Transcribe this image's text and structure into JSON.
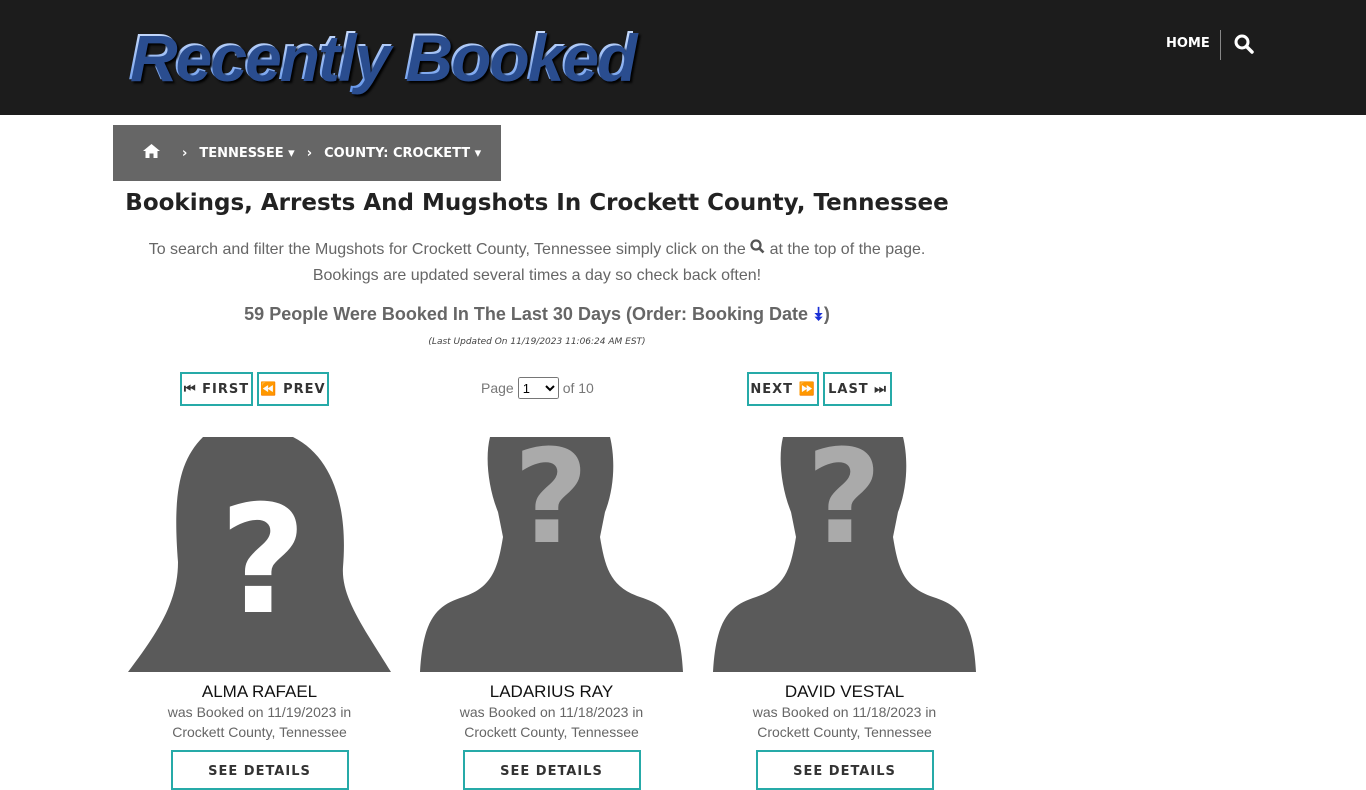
{
  "header": {
    "logo": "Recently Booked",
    "home": "HOME"
  },
  "breadcrumb": {
    "state": "TENNESSEE",
    "county": "COUNTY: CROCKETT"
  },
  "title": "Bookings, Arrests And Mugshots In Crockett County, Tennessee",
  "desc1a": "To search and filter the Mugshots for Crockett County, Tennessee simply click on the",
  "desc1b": "at the top of the page.",
  "desc2": "Bookings are updated several times a day so check back often!",
  "count": "59 People Were Booked In The Last 30 Days (Order: Booking Date",
  "count_end": ")",
  "updated": "(Last Updated On 11/19/2023 11:06:24 AM EST)",
  "pager": {
    "first": "FIRST",
    "prev": "PREV",
    "next": "NEXT",
    "last": "LAST",
    "page_label": "Page",
    "page": "1",
    "of": "of 10"
  },
  "cards": [
    {
      "name": "ALMA RAFAEL",
      "line1": "was Booked on 11/19/2023 in",
      "line2": "Crockett County, Tennessee",
      "button": "SEE DETAILS",
      "silhouette": "female"
    },
    {
      "name": "LADARIUS RAY",
      "line1": "was Booked on 11/18/2023 in",
      "line2": "Crockett County, Tennessee",
      "button": "SEE DETAILS",
      "silhouette": "male"
    },
    {
      "name": "DAVID VESTAL",
      "line1": "was Booked on 11/18/2023 in",
      "line2": "Crockett County, Tennessee",
      "button": "SEE DETAILS",
      "silhouette": "male"
    }
  ],
  "colors": {
    "header": "#1c1c1c",
    "breadcrumb": "#666666",
    "accent": "#26aaa8",
    "silhouette": "#5a5a5a"
  }
}
